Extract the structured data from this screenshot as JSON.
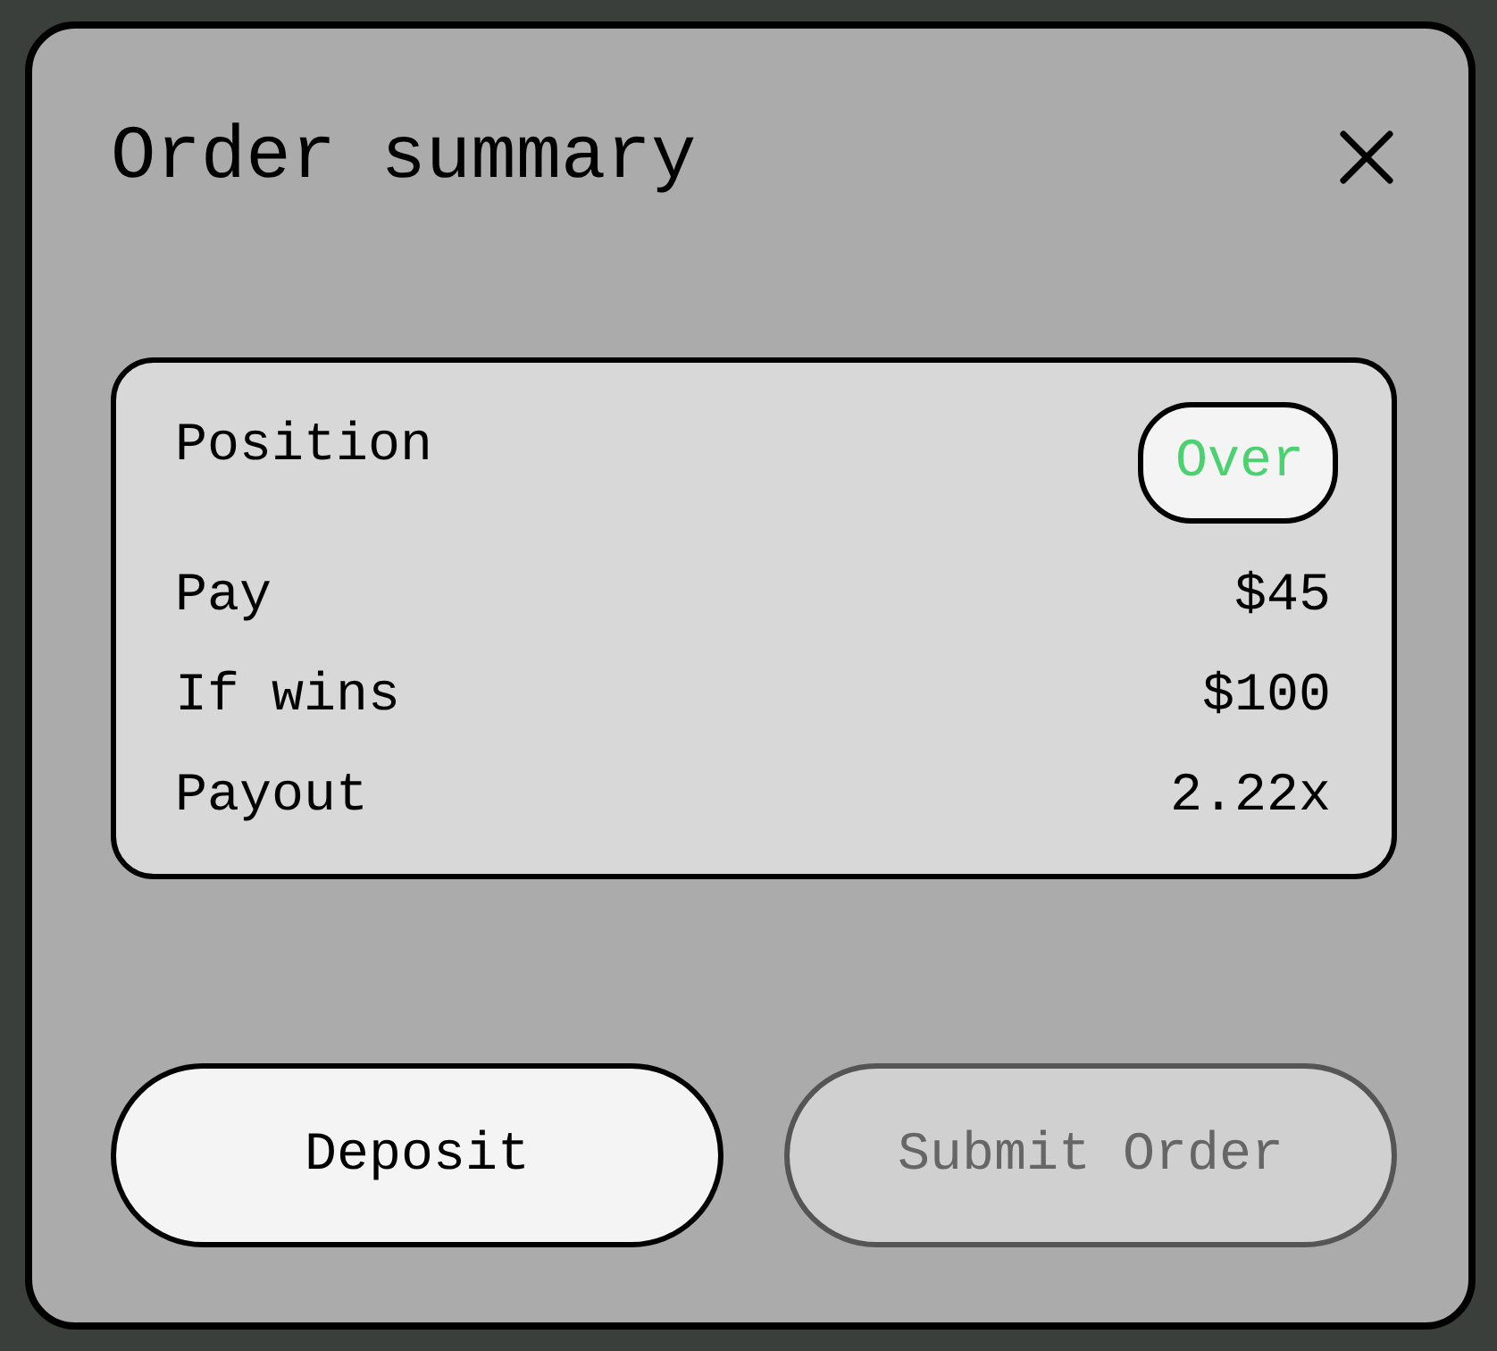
{
  "dialog": {
    "title": "Order summary"
  },
  "summary": [
    {
      "label": "Position",
      "value": "Over",
      "kind": "badge",
      "color": "#4cd170"
    },
    {
      "label": "Pay",
      "value": "$45",
      "kind": "text"
    },
    {
      "label": "If wins",
      "value": "$100",
      "kind": "text"
    },
    {
      "label": "Payout",
      "value": "2.22x",
      "kind": "text"
    }
  ],
  "buttons": [
    {
      "label": "Deposit",
      "disabled": false
    },
    {
      "label": "Submit Order",
      "disabled": true
    }
  ]
}
